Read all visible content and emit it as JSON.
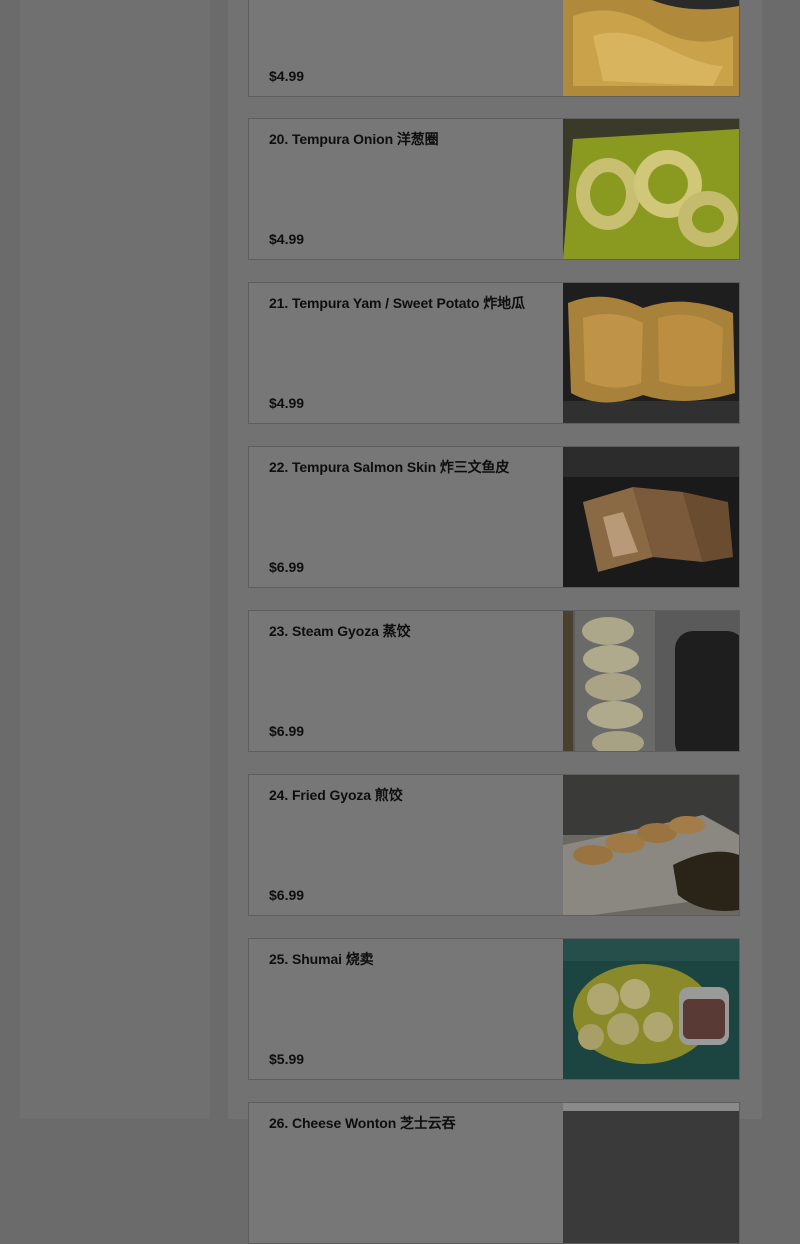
{
  "menu": {
    "items": [
      {
        "name": "",
        "price": "$4.99",
        "photo": "tempura-yam-photo"
      },
      {
        "name": "20. Tempura Onion 洋葱圈",
        "price": "$4.99",
        "photo": "tempura-onion-photo"
      },
      {
        "name": "21. Tempura Yam / Sweet Potato 炸地瓜",
        "price": "$4.99",
        "photo": "tempura-yam-photo"
      },
      {
        "name": "22. Tempura Salmon Skin 炸三文鱼皮",
        "price": "$6.99",
        "photo": "salmon-skin-photo"
      },
      {
        "name": "23. Steam Gyoza 蒸饺",
        "price": "$6.99",
        "photo": "steam-gyoza-photo"
      },
      {
        "name": "24. Fried Gyoza 煎饺",
        "price": "$6.99",
        "photo": "fried-gyoza-photo"
      },
      {
        "name": "25. Shumai 烧卖",
        "price": "$5.99",
        "photo": "shumai-photo"
      },
      {
        "name": "26. Cheese Wonton 芝士云吞",
        "price": "",
        "photo": "cheese-wonton-photo"
      }
    ]
  }
}
